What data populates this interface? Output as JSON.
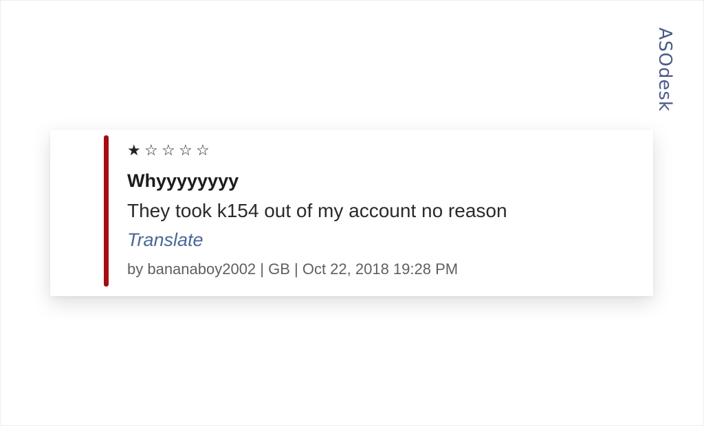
{
  "watermark": {
    "text": "ASOdesk"
  },
  "review": {
    "rating": 1,
    "max_rating": 5,
    "star_filled": "★",
    "star_empty": "☆",
    "title": "Whyyyyyyyy",
    "body": "They took k154 out of my account no reason",
    "translate_label": "Translate",
    "meta": "by bananaboy2002 | GB | Oct 22, 2018 19:28 PM"
  },
  "colors": {
    "accent_bar": "#a60d12",
    "translate_link": "#4a6796",
    "watermark": "#4a5a8a"
  }
}
